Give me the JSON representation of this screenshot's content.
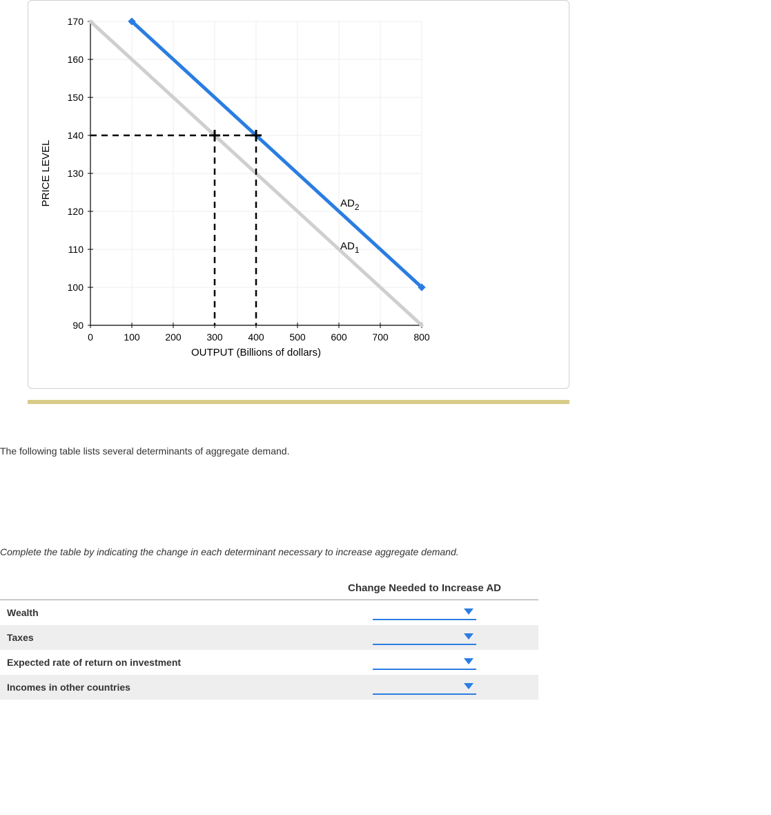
{
  "chart_data": {
    "type": "line",
    "xlabel": "OUTPUT (Billions of dollars)",
    "ylabel": "PRICE LEVEL",
    "xlim": [
      0,
      800
    ],
    "ylim": [
      90,
      170
    ],
    "xticks": [
      0,
      100,
      200,
      300,
      400,
      500,
      600,
      700,
      800
    ],
    "yticks": [
      90,
      100,
      110,
      120,
      130,
      140,
      150,
      160,
      170
    ],
    "series": [
      {
        "name": "AD1",
        "color": "#cfcfcf",
        "points": [
          [
            0,
            170
          ],
          [
            800,
            90
          ]
        ]
      },
      {
        "name": "AD2",
        "color": "#2a7de1",
        "points": [
          [
            100,
            170
          ],
          [
            800,
            100
          ]
        ]
      }
    ],
    "reference_lines": {
      "price_level": 140,
      "output_ad1": 300,
      "output_ad2": 400
    },
    "labels": [
      {
        "text": "AD2",
        "subscript": "2",
        "x": 560,
        "y": 122
      },
      {
        "text": "AD1",
        "subscript": "1",
        "x": 560,
        "y": 112
      }
    ]
  },
  "text": {
    "question": "The following table lists several determinants of aggregate demand.",
    "instruction": "Complete the table by indicating the change in each determinant necessary to increase aggregate demand."
  },
  "table": {
    "header": "Change Needed to Increase AD",
    "rows": [
      {
        "label": "Wealth"
      },
      {
        "label": "Taxes"
      },
      {
        "label": "Expected rate of return on investment"
      },
      {
        "label": "Incomes in other countries"
      }
    ]
  }
}
